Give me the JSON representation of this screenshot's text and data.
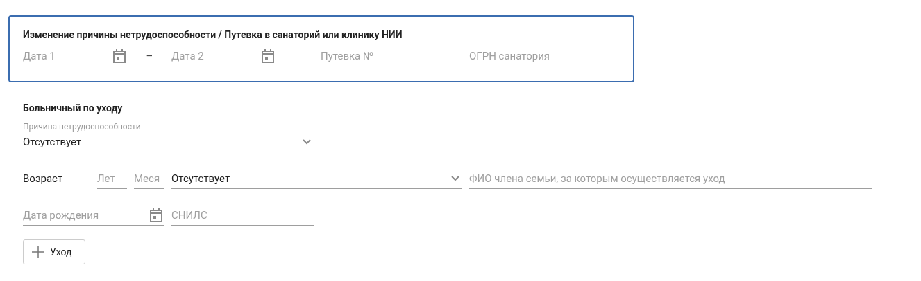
{
  "card": {
    "title": "Изменение причины нетрудоспособности / Путевка в санаторий или клинику НИИ",
    "date_from": {
      "placeholder": "Дата 1"
    },
    "separator": "–",
    "date_to": {
      "placeholder": "Дата 2"
    },
    "voucher": {
      "placeholder": "Путевка №"
    },
    "ogrn": {
      "placeholder": "ОГРН санатория"
    }
  },
  "care": {
    "title": "Больничный по уходу",
    "reason": {
      "label": "Причина нетрудоспособности",
      "value": "Отсутствует"
    },
    "age_label": "Возраст",
    "years": {
      "placeholder": "Лет"
    },
    "months": {
      "placeholder": "Меся"
    },
    "relation": {
      "value": "Отсутствует"
    },
    "family_member": {
      "placeholder": "ФИО члена семьи, за которым осуществляется уход"
    },
    "birth_date": {
      "placeholder": "Дата рождения"
    },
    "snils": {
      "placeholder": "СНИЛС"
    },
    "add_button": "Уход"
  }
}
